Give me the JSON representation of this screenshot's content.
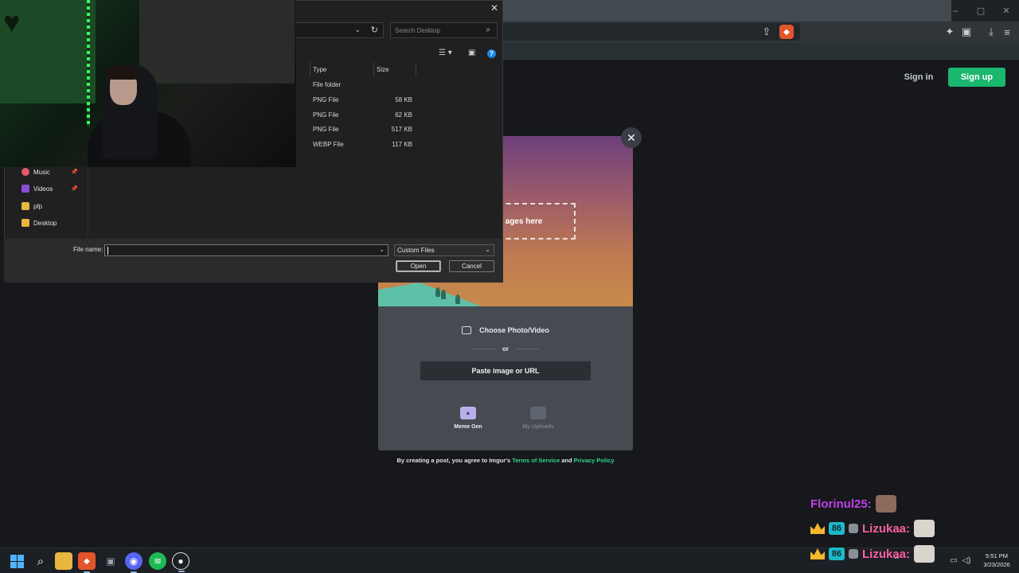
{
  "browser": {
    "win_controls": [
      "–",
      "▢",
      "✕"
    ]
  },
  "imgur": {
    "sign_in": "Sign in",
    "sign_up": "Sign up",
    "drop_text": "ages here",
    "choose_photo": "Choose Photo/Video",
    "or": "or",
    "paste": "Paste image or URL",
    "meme_gen": "Meme Gen",
    "my_uploads": "My Uploads",
    "terms_prefix": "By creating a post, you agree to Imgur's",
    "terms_link": "Terms of Service",
    "terms_and": "and",
    "privacy_link": "Privacy Policy"
  },
  "dialog": {
    "search_placeholder": "Search Desktop",
    "columns": {
      "type": "Type",
      "size": "Size"
    },
    "files": [
      {
        "type": "File folder",
        "size": ""
      },
      {
        "type": "PNG File",
        "size": "58 KB"
      },
      {
        "type": "PNG File",
        "size": "62 KB"
      },
      {
        "type": "PNG File",
        "size": "517 KB"
      },
      {
        "type": "WEBP File",
        "size": "117 KB"
      }
    ],
    "nav": [
      {
        "label": "Music",
        "color": "#e05a6a"
      },
      {
        "label": "Videos",
        "color": "#8a4fd6"
      },
      {
        "label": "pfp",
        "color": "#e8b740"
      },
      {
        "label": "Desktop",
        "color": "#e8b740"
      }
    ],
    "file_name_label": "File name:",
    "file_name_value": "",
    "filter": "Custom Files",
    "open": "Open",
    "cancel": "Cancel"
  },
  "chat": [
    {
      "name": "Florinul25:",
      "color": "#c040e8",
      "badges": false
    },
    {
      "name": "Lizukaa:",
      "color": "#ff5fa2",
      "badges": true
    },
    {
      "name": "Lizukaa:",
      "color": "#ff5fa2",
      "badges": true
    }
  ],
  "tray": {
    "time": "5:51 PM",
    "date": "3/23/2026"
  },
  "colors": {
    "imgur_green": "#1bb76e",
    "link_green": "#2fd68a"
  }
}
